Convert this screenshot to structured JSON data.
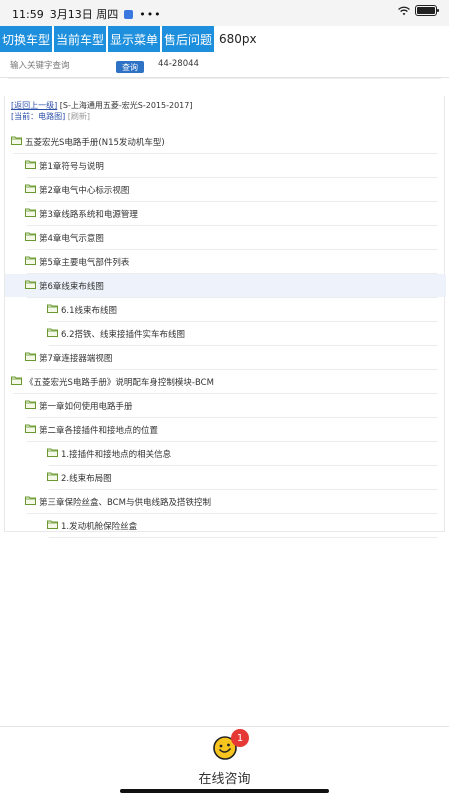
{
  "status_bar": {
    "time": "11:59",
    "date": "3月13日 周四",
    "more": "•••",
    "battery_level": 0.9
  },
  "toolbar": {
    "buttons": [
      "切换车型",
      "当前车型",
      "显示菜单",
      "售后问题"
    ],
    "size_text": "680px"
  },
  "search": {
    "placeholder": "输入关键字查询",
    "query_button": "查询",
    "code": "44-28044"
  },
  "breadcrumb": {
    "back_link": "[返回上一级]",
    "model": "[S-上海通用五菱-宏光S-2015-2017]",
    "current": "[当前：电路图]",
    "refresh": "[刷新]"
  },
  "tree": [
    {
      "label": "五菱宏光S电路手册(N15发动机车型)",
      "level": 0
    },
    {
      "label": "第1章符号与说明",
      "level": 1
    },
    {
      "label": "第2章电气中心标示视图",
      "level": 1
    },
    {
      "label": "第3章线路系统和电源管理",
      "level": 1
    },
    {
      "label": "第4章电气示意图",
      "level": 1
    },
    {
      "label": "第5章主要电气部件列表",
      "level": 1
    },
    {
      "label": "第6章线束布线图",
      "level": 1,
      "selected": true
    },
    {
      "label": "6.1线束布线图",
      "level": 2
    },
    {
      "label": "6.2搭铁、线束接插件实车布线图",
      "level": 2
    },
    {
      "label": "第7章连接器端视图",
      "level": 1
    },
    {
      "label": "《五菱宏光S电路手册》说明配车身控制模块-BCM",
      "level": 0
    },
    {
      "label": "第一章如何使用电路手册",
      "level": 1
    },
    {
      "label": "第二章各接插件和接地点的位置",
      "level": 1
    },
    {
      "label": "1.接插件和接地点的相关信息",
      "level": 2
    },
    {
      "label": "2.线束布局图",
      "level": 2
    },
    {
      "label": "第三章保险丝盒、BCM与供电线路及搭铁控制",
      "level": 1
    },
    {
      "label": "1.发动机舱保险丝盒",
      "level": 2
    }
  ],
  "chat": {
    "label": "在线咨询",
    "badge": "1"
  }
}
